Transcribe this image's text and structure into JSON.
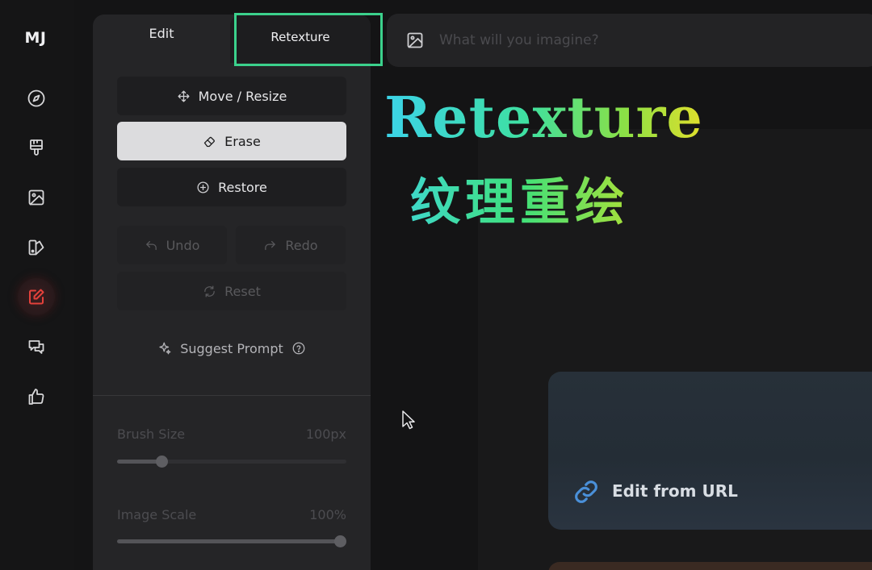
{
  "sidebar": {
    "logo": "MJ",
    "items": [
      {
        "name": "explore",
        "icon": "compass-icon"
      },
      {
        "name": "create",
        "icon": "brush-icon"
      },
      {
        "name": "organize",
        "icon": "image-icon"
      },
      {
        "name": "personalize",
        "icon": "palette-icon"
      },
      {
        "name": "edit",
        "icon": "edit-icon",
        "active": true
      },
      {
        "name": "chat",
        "icon": "chat-icon"
      },
      {
        "name": "rank",
        "icon": "thumbs-up-icon"
      }
    ],
    "active_color": "#e3413b"
  },
  "tabs": {
    "edit_label": "Edit",
    "retexture_label": "Retexture",
    "highlight_color": "#3bd18c"
  },
  "tools": {
    "move_resize": "Move / Resize",
    "erase": "Erase",
    "restore": "Restore",
    "undo": "Undo",
    "redo": "Redo",
    "reset": "Reset",
    "suggest_prompt": "Suggest Prompt"
  },
  "sliders": {
    "brush_size": {
      "label": "Brush Size",
      "value": "100px",
      "fraction": 0.18
    },
    "image_scale": {
      "label": "Image Scale",
      "value": "100%",
      "fraction": 1.0
    }
  },
  "prompt": {
    "placeholder": "What will you imagine?",
    "value": ""
  },
  "overlay": {
    "title": "Retexture",
    "subtitle": "纹理重绘"
  },
  "card": {
    "label": "Edit from URL",
    "icon": "link-icon",
    "icon_color": "#4a90d9"
  }
}
